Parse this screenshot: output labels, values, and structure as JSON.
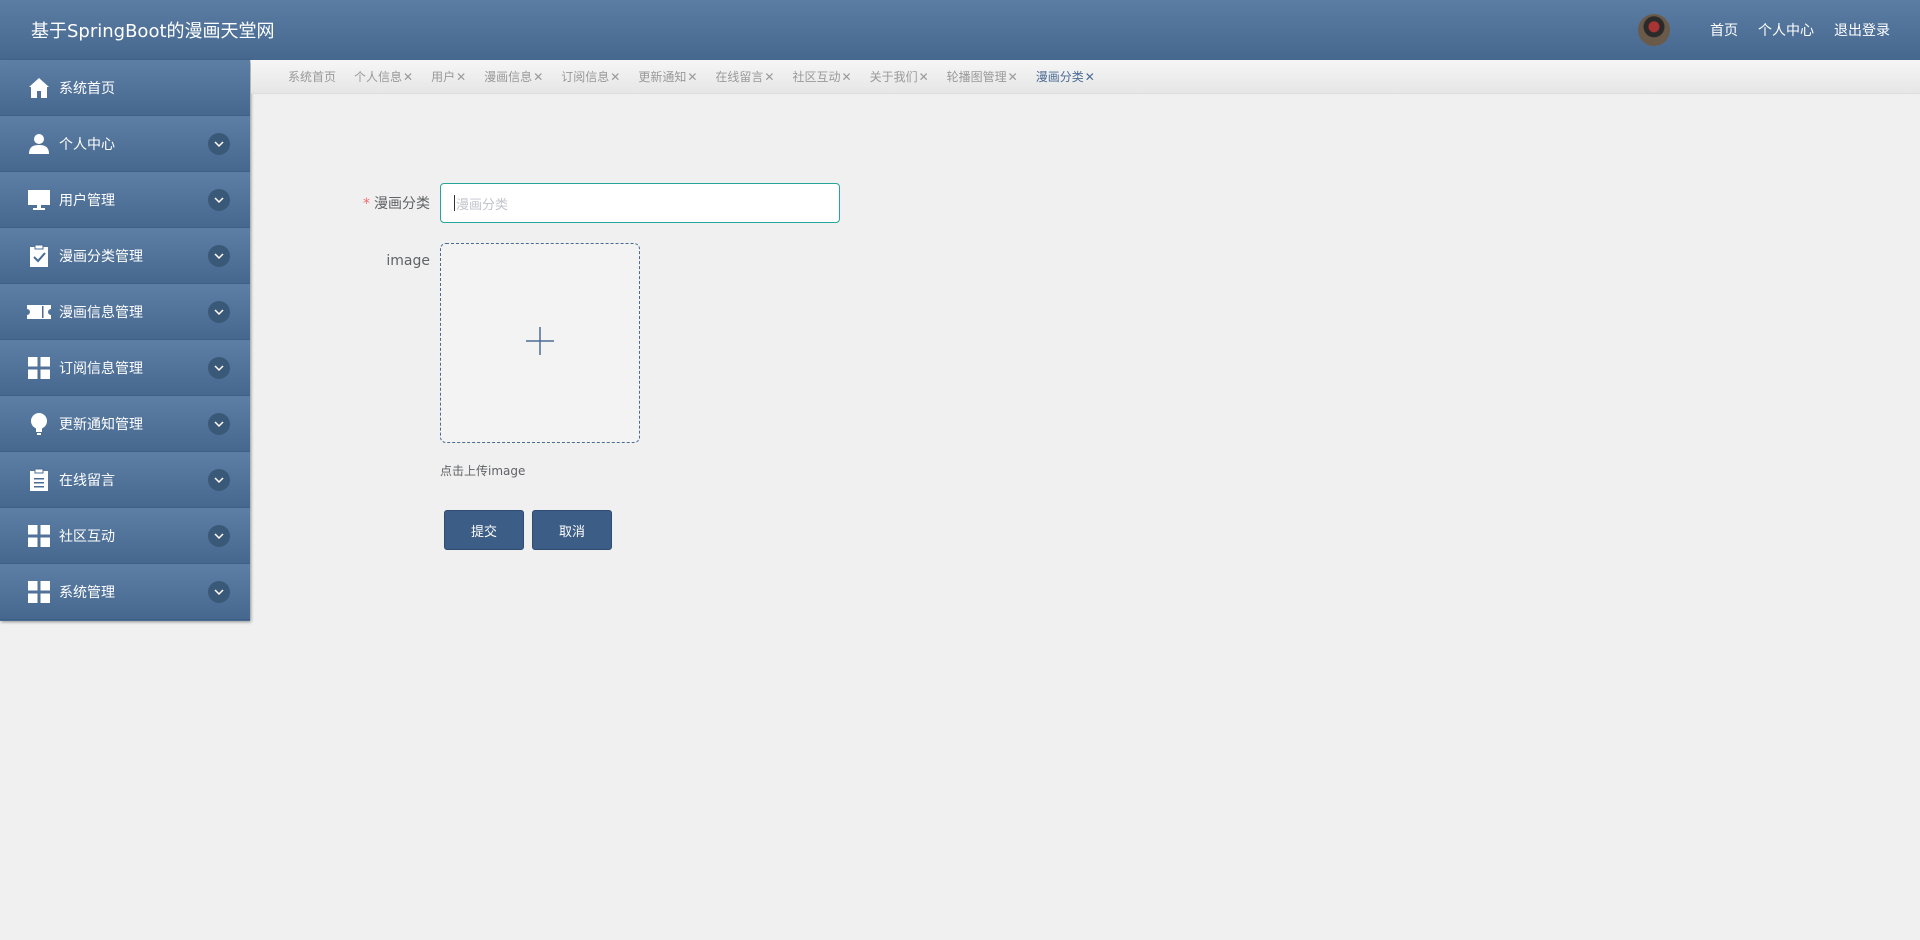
{
  "header": {
    "title": "基于SpringBoot的漫画天堂网",
    "links": [
      "首页",
      "个人中心",
      "退出登录"
    ]
  },
  "sidebar": {
    "items": [
      {
        "label": "系统首页",
        "icon": "home-icon"
      },
      {
        "label": "个人中心",
        "icon": "user-icon"
      },
      {
        "label": "用户管理",
        "icon": "monitor-icon"
      },
      {
        "label": "漫画分类管理",
        "icon": "clipboard-check-icon"
      },
      {
        "label": "漫画信息管理",
        "icon": "ticket-icon"
      },
      {
        "label": "订阅信息管理",
        "icon": "grid-icon"
      },
      {
        "label": "更新通知管理",
        "icon": "lightbulb-icon"
      },
      {
        "label": "在线留言",
        "icon": "clipboard-icon"
      },
      {
        "label": "社区互动",
        "icon": "grid-icon"
      },
      {
        "label": "系统管理",
        "icon": "grid-icon"
      }
    ]
  },
  "tabs": [
    {
      "label": "系统首页",
      "closable": false
    },
    {
      "label": "个人信息",
      "closable": true
    },
    {
      "label": "用户",
      "closable": true
    },
    {
      "label": "漫画信息",
      "closable": true
    },
    {
      "label": "订阅信息",
      "closable": true
    },
    {
      "label": "更新通知",
      "closable": true
    },
    {
      "label": "在线留言",
      "closable": true
    },
    {
      "label": "社区互动",
      "closable": true
    },
    {
      "label": "关于我们",
      "closable": true
    },
    {
      "label": "轮播图管理",
      "closable": true
    },
    {
      "label": "漫画分类",
      "closable": true,
      "active": true
    }
  ],
  "tab_close_glyph": "✕",
  "form": {
    "category_label": "漫画分类",
    "required_mark": "*",
    "category_placeholder": "漫画分类",
    "category_value": "",
    "image_label": "image",
    "upload_tip": "点击上传image",
    "submit_label": "提交",
    "cancel_label": "取消"
  },
  "colors": {
    "header": "#4f7199",
    "sidebar": "#4a6c93",
    "input_focus_border": "#26a69a",
    "button": "#3c5d85"
  }
}
